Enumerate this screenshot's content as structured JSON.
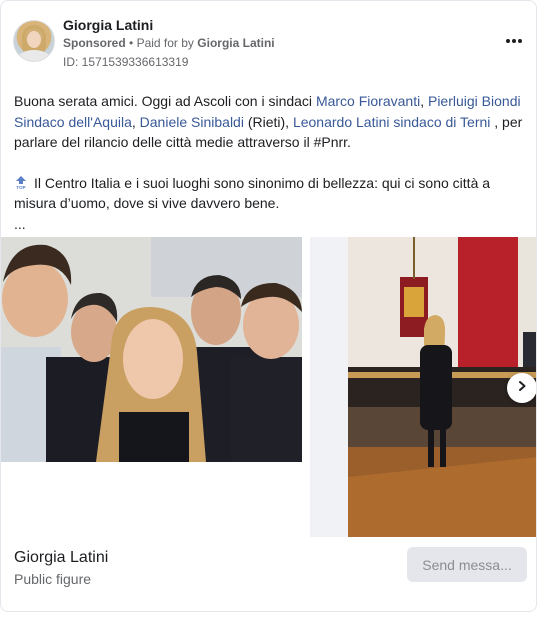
{
  "ad": {
    "page_name": "Giorgia Latini",
    "sponsored_label": "Sponsored",
    "separator": "•",
    "paid_for_prefix": "Paid for by",
    "paid_for_name": "Giorgia Latini",
    "id_label": "ID: 1571539336613319",
    "more_icon": "more-horizontal-icon"
  },
  "body": {
    "line1_start": "Buona serata amici. Oggi ad Ascoli con i sindaci ",
    "mention1": "Marco Fioravanti",
    "sep1": ", ",
    "mention2": "Pierluigi Biondi Sindaco dell'Aquila",
    "sep2": ", ",
    "mention3": "Daniele Sinibaldi",
    "text3": " (Rieti), ",
    "mention4": "Leonardo Latini sindaco di Terni",
    "text4": " , per parlare del rilancio delle città medie attraverso il #Pnrr.",
    "p2_icon": "top-arrow-icon",
    "paragraph2": "Il Centro Italia e i suoi luoghi sono sinonimo di bellezza: qui ci sono città a misura d’uomo, dove si vive davvero bene.",
    "ellipsis": "..."
  },
  "carousel": {
    "next_icon": "chevron-right-icon"
  },
  "footer": {
    "page_name": "Giorgia Latini",
    "category": "Public figure",
    "cta_label": "Send messa..."
  },
  "colors": {
    "link": "#385898",
    "muted": "#65676b",
    "button_bg": "#e4e6eb",
    "button_text": "#8a8d91"
  }
}
